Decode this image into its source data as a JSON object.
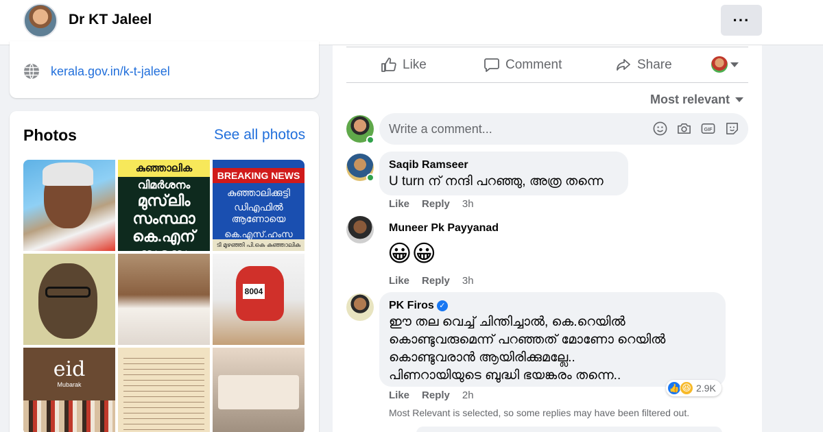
{
  "header": {
    "name": "Dr KT Jaleel",
    "more_label": "···"
  },
  "intro": {
    "website": "kerala.gov.in/k-t-jaleel"
  },
  "photos": {
    "title": "Photos",
    "see_all": "See all photos",
    "tile2": {
      "l1": "കുഞ്ഞാലിക",
      "l2": "വിമർശനം",
      "l3": "മുസ്‌ലിം",
      "l4": "സംസ്ഥാ",
      "l5": "കെ.എന്",
      "l6": "സസ്പെ"
    },
    "tile3": {
      "breaking": "BREAKING NEWS",
      "l1": "കുഞ്ഞാലിക്കുട്ടി",
      "l2": "ഡിഎഫിൽ ആണോയെ",
      "l3": "കെ.എസ്.ഹംസ",
      "l4": "ടി മുഴഞ്ഞി പി.കെ കുഞ്ഞാലിക"
    },
    "tile6": {
      "bib": "8004"
    },
    "tile7": {
      "eid": "eid",
      "sub": "Mubarak"
    }
  },
  "actions": {
    "like": "Like",
    "comment": "Comment",
    "share": "Share"
  },
  "sort": {
    "label": "Most relevant"
  },
  "composer": {
    "placeholder": "Write a comment..."
  },
  "comments": [
    {
      "author": "Saqib Ramseer",
      "text": "U turn ന് നന്ദി പറഞ്ഞു, അത്ര തന്നെ",
      "like": "Like",
      "reply": "Reply",
      "time": "3h"
    },
    {
      "author": "Muneer Pk Payyanad",
      "text": "😀😀",
      "like": "Like",
      "reply": "Reply",
      "time": "3h"
    },
    {
      "author": "PK Firos",
      "verified": true,
      "lines": [
        "ഈ തല വെച്ച് ചിന്തിച്ചാൽ, കെ.റെയിൽ",
        "കൊണ്ടുവരുമെന്ന് പറഞ്ഞത് മോണോ റെയിൽ",
        "കൊണ്ടുവരാൻ ആയിരിക്കുമല്ലേ..",
        "പിണറായിയുടെ ബുദ്ധി ഭയങ്കരം തന്നെ.."
      ],
      "like": "Like",
      "reply": "Reply",
      "time": "2h",
      "reaction_count": "2.9K"
    }
  ],
  "filter_note": "Most Relevant is selected, so some replies may have been filtered out.",
  "colors": {
    "link": "#216fdb",
    "muted": "#65676b",
    "bubble": "#f0f2f5",
    "online": "#31a24c"
  }
}
